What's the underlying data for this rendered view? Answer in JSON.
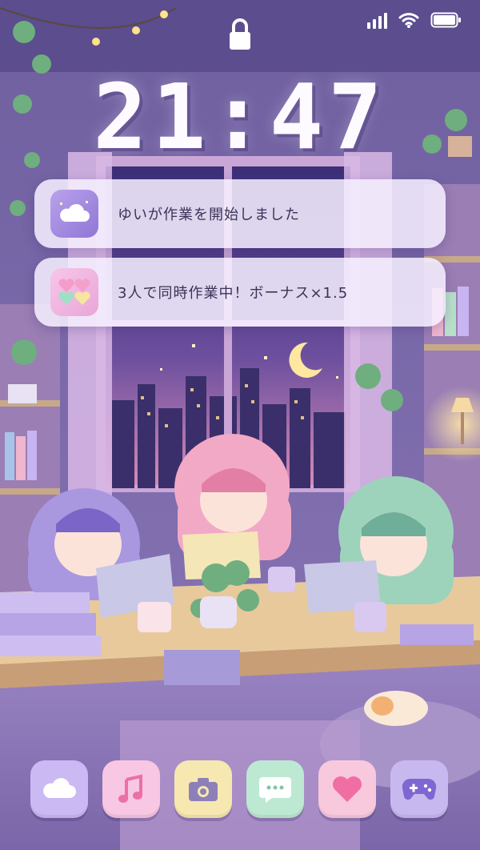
{
  "status_bar": {
    "signal_icon": "cellular-signal-icon",
    "wifi_icon": "wifi-icon",
    "battery_icon": "battery-icon"
  },
  "lock_icon": "padlock-icon",
  "clock": {
    "time": "21:47"
  },
  "notifications": [
    {
      "icon": "cloud-app-icon",
      "text": "ゆいが作業を開始しました"
    },
    {
      "icon": "hearts-app-icon",
      "text": "3人で同時作業中！ボーナス×1.5"
    }
  ],
  "dock": [
    {
      "icon": "cloud-icon",
      "color": "#cbb9f4"
    },
    {
      "icon": "music-note-icon",
      "color": "#f7c7e3"
    },
    {
      "icon": "camera-icon",
      "color": "#f6e8b0"
    },
    {
      "icon": "chat-bubble-icon",
      "color": "#bde9d2"
    },
    {
      "icon": "heart-icon",
      "color": "#f8c9dd"
    },
    {
      "icon": "gamepad-icon",
      "color": "#c7b9f0"
    }
  ],
  "colors": {
    "accent": "#8f76d6",
    "pink": "#f06ea3",
    "text": "#3b3357"
  }
}
